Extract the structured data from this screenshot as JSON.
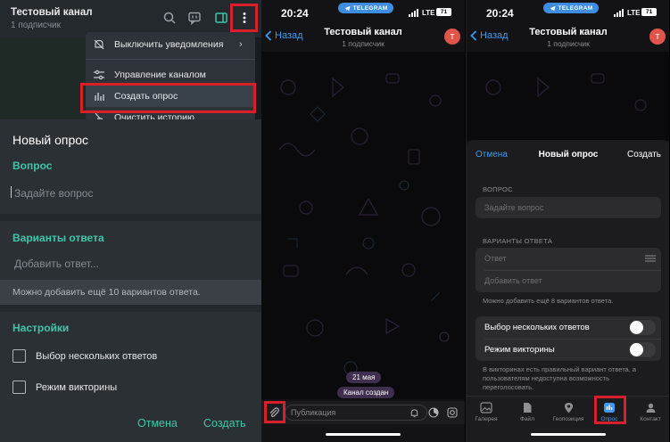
{
  "desktop": {
    "channel_title": "Тестовый канал",
    "channel_subtitle": "1 подписчик",
    "menu": {
      "items": [
        {
          "label": "Выключить уведомления",
          "icon": "bell-off-icon"
        },
        {
          "label": "Управление каналом",
          "icon": "sliders-icon"
        },
        {
          "label": "Создать опрос",
          "icon": "poll-icon"
        },
        {
          "label": "Очистить историю",
          "icon": "broom-icon"
        }
      ]
    },
    "poll": {
      "heading": "Новый опрос",
      "question_section": "Вопрос",
      "question_placeholder": "Задайте вопрос",
      "answers_section": "Варианты ответа",
      "add_answer_placeholder": "Добавить ответ...",
      "hint": "Можно добавить ещё 10 вариантов ответа.",
      "settings_section": "Настройки",
      "options": [
        "Выбор нескольких ответов",
        "Режим викторины"
      ],
      "cancel": "Отмена",
      "create": "Создать"
    }
  },
  "ios_chat": {
    "time": "20:24",
    "app_pill": "TELEGRAM",
    "network": "LTE",
    "battery": "71",
    "back_label": "Назад",
    "channel_title": "Тестовый канал",
    "channel_subtitle": "1 подписчик",
    "avatar_letter": "Т",
    "date_label": "21 мая",
    "service_message": "Канал создан",
    "input_placeholder": "Публикация"
  },
  "ios_poll": {
    "time": "20:24",
    "app_pill": "TELEGRAM",
    "network": "LTE",
    "battery": "71",
    "back_label": "Назад",
    "channel_title": "Тестовый канал",
    "channel_subtitle": "1 подписчик",
    "avatar_letter": "Т",
    "sheet": {
      "cancel": "Отмена",
      "title": "Новый опрос",
      "create": "Создать",
      "question_section": "ВОПРОС",
      "question_placeholder": "Задайте вопрос",
      "answers_section": "ВАРИАНТЫ ОТВЕТА",
      "answer_placeholder": "Ответ",
      "add_answer": "Добавить ответ",
      "hint": "Можно добавить ещё 8 вариантов ответа.",
      "options": [
        "Выбор нескольких ответов",
        "Режим викторины"
      ],
      "quiz_note": "В викторинах есть правильный вариант ответа, а пользователям недоступна возможность переголосовать."
    },
    "tabs": [
      {
        "label": "Галерея",
        "icon": "gallery-icon"
      },
      {
        "label": "Файл",
        "icon": "file-icon"
      },
      {
        "label": "Геопозиция",
        "icon": "location-icon"
      },
      {
        "label": "Опрос",
        "icon": "poll-icon",
        "active": true
      },
      {
        "label": "Контакт",
        "icon": "contact-icon"
      }
    ]
  },
  "colors": {
    "desktop_accent": "#3fc6a9",
    "ios_accent": "#3e9bef",
    "highlight_red": "#d9202a"
  }
}
